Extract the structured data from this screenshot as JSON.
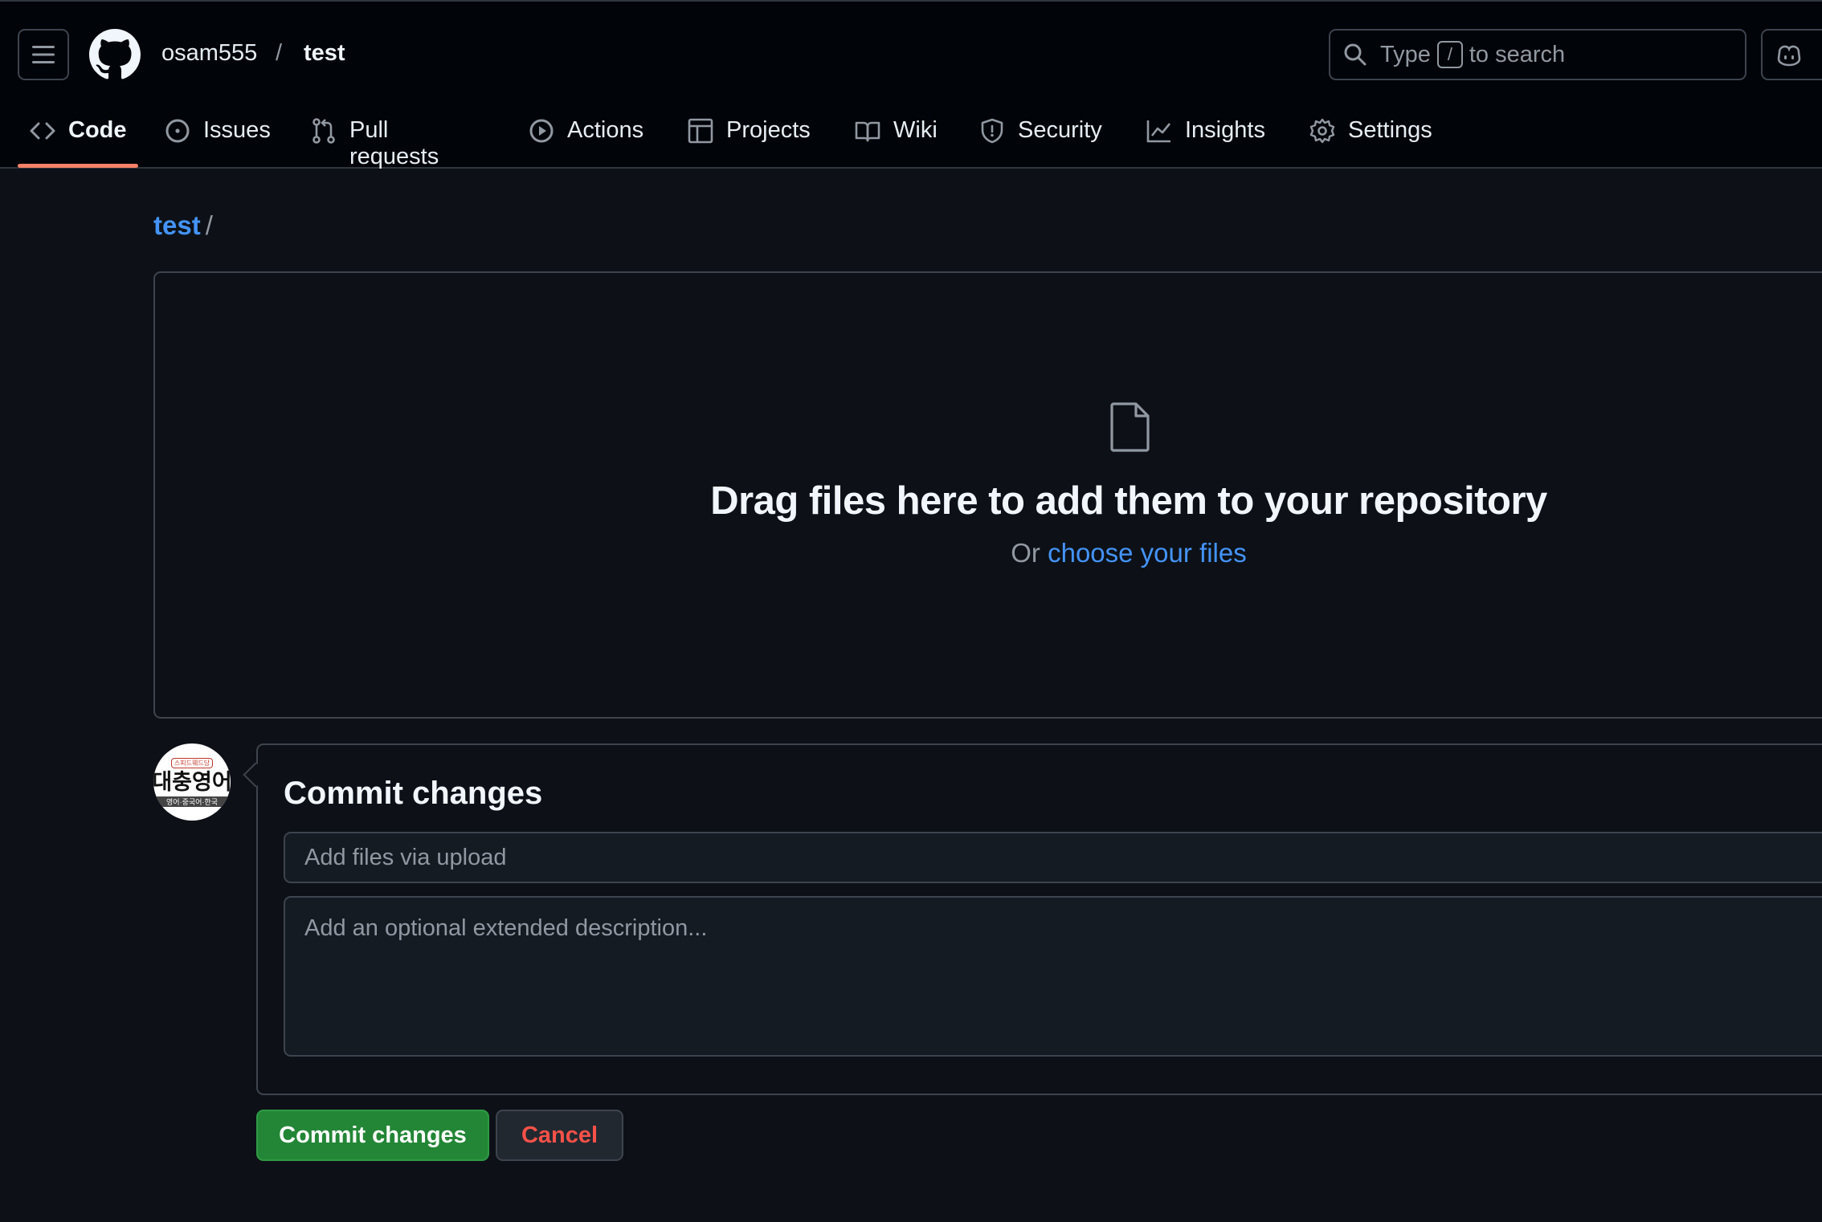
{
  "header": {
    "owner": "osam555",
    "separator": "/",
    "repo": "test",
    "search": {
      "prefix": "Type",
      "key": "/",
      "suffix": "to search"
    }
  },
  "tabs": [
    {
      "label": "Code",
      "icon": "code-icon",
      "active": true
    },
    {
      "label": "Issues",
      "icon": "issue-opened-icon"
    },
    {
      "label": "Pull requests",
      "icon": "git-pull-request-icon"
    },
    {
      "label": "Actions",
      "icon": "play-icon"
    },
    {
      "label": "Projects",
      "icon": "table-icon"
    },
    {
      "label": "Wiki",
      "icon": "book-icon"
    },
    {
      "label": "Security",
      "icon": "shield-icon"
    },
    {
      "label": "Insights",
      "icon": "graph-icon"
    },
    {
      "label": "Settings",
      "icon": "gear-icon"
    }
  ],
  "path": {
    "repo": "test",
    "slash": "/"
  },
  "dropzone": {
    "title": "Drag files here to add them to your repository",
    "or": "Or",
    "choose": "choose your files"
  },
  "avatar": {
    "top": "스피드웨드당",
    "main": "대충영어",
    "bottom": "영어·중국어·한국"
  },
  "commit": {
    "title": "Commit changes",
    "summary_placeholder": "Add files via upload",
    "description_placeholder": "Add an optional extended description...",
    "commit_button": "Commit changes",
    "cancel_button": "Cancel"
  },
  "colors": {
    "accent_link": "#4493f8",
    "active_tab_underline": "#f78166",
    "commit_green": "#238636",
    "cancel_red": "#f85149"
  }
}
